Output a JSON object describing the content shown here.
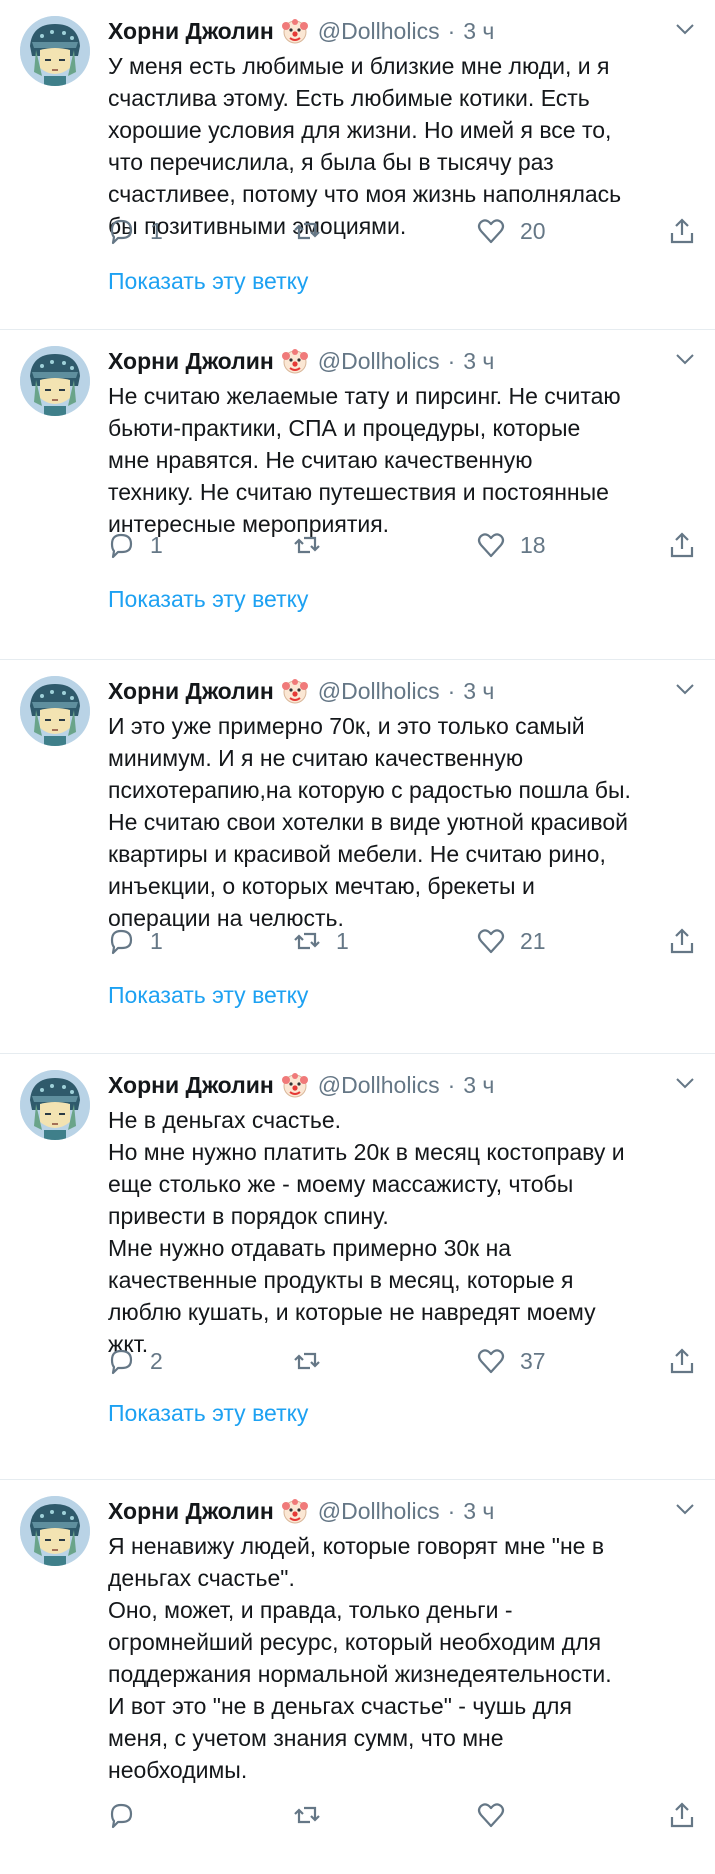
{
  "colors": {
    "accent": "#1da1f2",
    "muted": "#657786",
    "text": "#14171a",
    "divider": "#e6ecf0"
  },
  "icons": {
    "avatar": "anime-avatar",
    "badge": "clown-face-emoji",
    "menu": "chevron-down-icon",
    "reply": "reply-icon",
    "retweet": "retweet-icon",
    "like": "heart-icon",
    "share": "share-icon"
  },
  "tweets": [
    {
      "name": "Хорни Джолин",
      "handle": "@Dollholics",
      "sep": "·",
      "time": "3 ч",
      "text": "У меня есть любимые и близкие мне люди, и я\nсчастлива этому. Есть любимые котики. Есть\nхорошие условия для жизни. Но имей я все то,\nчто перечислила, я была бы в тысячу раз\nсчастливее, потому что моя жизнь наполнялась\nбы позитивными эмоциями.",
      "replies": "1",
      "retweets": "",
      "likes": "20",
      "thread_link": "Показать эту ветку"
    },
    {
      "name": "Хорни Джолин",
      "handle": "@Dollholics",
      "sep": "·",
      "time": "3 ч",
      "text": "Не считаю желаемые тату и пирсинг. Не считаю\nбьюти-практики,  СПА и процедуры, которые\nмне нравятся.  Не считаю качественную\nтехнику. Не считаю путешествия и постоянные\nинтересные мероприятия.",
      "replies": "1",
      "retweets": "",
      "likes": "18",
      "thread_link": "Показать эту ветку"
    },
    {
      "name": "Хорни Джолин",
      "handle": "@Dollholics",
      "sep": "·",
      "time": "3 ч",
      "text": "И это уже примерно 70к, и это только самый\nминимум. И я не считаю качественную\nпсихотерапию,на которую с радостью пошла бы.\nНе считаю свои хотелки в виде уютной красивой\nквартиры и красивой мебели. Не считаю рино,\nинъекции, о которых мечтаю, брекеты и\nоперации на челюсть.",
      "replies": "1",
      "retweets": "1",
      "likes": "21",
      "thread_link": "Показать эту ветку"
    },
    {
      "name": "Хорни Джолин",
      "handle": "@Dollholics",
      "sep": "·",
      "time": "3 ч",
      "text": "Не в деньгах счастье.\nНо мне нужно платить 20к в месяц костоправу и\nеще столько же - моему массажисту, чтобы\nпривести в порядок спину.\nМне нужно отдавать примерно 30к на\nкачественные продукты в месяц, которые я\nлюблю кушать, и которые не навредят моему\nжкт.",
      "replies": "2",
      "retweets": "",
      "likes": "37",
      "thread_link": "Показать эту ветку"
    },
    {
      "name": "Хорни Джолин",
      "handle": "@Dollholics",
      "sep": "·",
      "time": "3 ч",
      "text": "Я ненавижу людей, которые говорят мне \"не в\nденьгах счастье\".\nОно, может, и правда, только деньги -\nогромнейший ресурс, который необходим для\nподдержания нормальной жизнедеятельности.\nИ вот это \"не в деньгах счастье\" - чушь для\nменя, с учетом знания сумм, что мне\nнеобходимы.",
      "replies": "",
      "retweets": "",
      "likes": "",
      "thread_link": ""
    }
  ]
}
